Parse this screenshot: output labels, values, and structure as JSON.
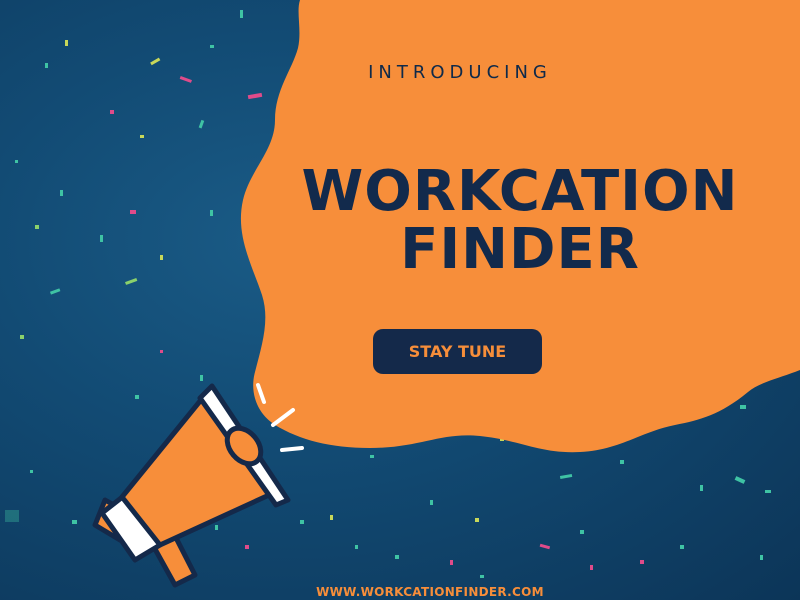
{
  "announcement": {
    "kicker": "INTRODUCING",
    "title_line1": "WORKCATION",
    "title_line2": "FINDER",
    "button_label": "STAY TUNE",
    "website": "WWW.WORKCATIONFINDER.COM"
  },
  "icons": [
    "megaphone-icon"
  ],
  "colors": {
    "background": "#124b74",
    "accent_orange": "#f78e3a",
    "navy_text": "#122a4c"
  }
}
